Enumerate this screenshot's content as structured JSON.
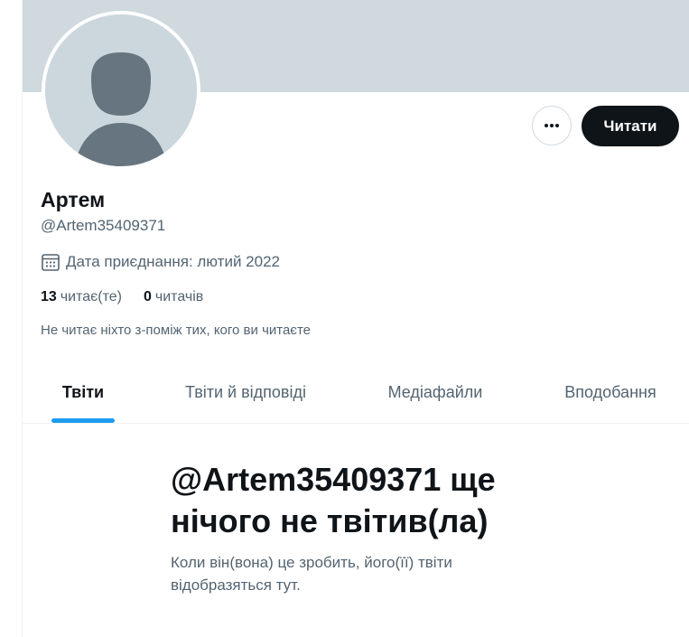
{
  "profile": {
    "display_name": "Артем",
    "handle": "@Artem35409371",
    "join_date": "Дата приєднання: лютий 2022",
    "following_count": "13",
    "following_label": "читає(те)",
    "followers_count": "0",
    "followers_label": "читачів",
    "followers_note": "Не читає ніхто з-поміж тих, кого ви читаєте"
  },
  "actions": {
    "more_icon": "more-dots-icon",
    "follow_label": "Читати"
  },
  "tabs": [
    {
      "label": "Твіти",
      "active": true
    },
    {
      "label": "Твіти й відповіді",
      "active": false
    },
    {
      "label": "Медіафайли",
      "active": false
    },
    {
      "label": "Вподобання",
      "active": false
    }
  ],
  "empty_state": {
    "title": "@Artem35409371 ще нічого не твітив(ла)",
    "subtitle": "Коли він(вона) це зробить, його(її) твіти відобразяться тут."
  },
  "colors": {
    "banner": "#cfd9de",
    "accent": "#1d9bf0",
    "primary_text": "#0f1419",
    "secondary_text": "#536471"
  }
}
